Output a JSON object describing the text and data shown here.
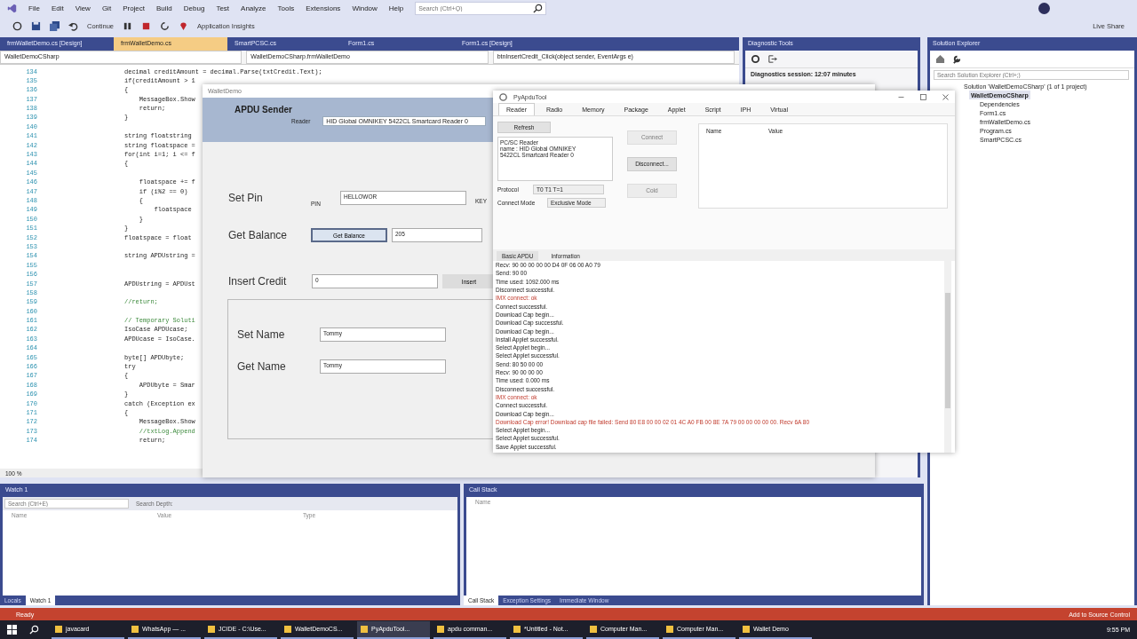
{
  "menu": [
    "File",
    "Edit",
    "View",
    "Git",
    "Project",
    "Build",
    "Debug",
    "Test",
    "Analyze",
    "Tools",
    "Extensions",
    "Window",
    "Help"
  ],
  "search": {
    "placeholder": "Search (Ctrl+Q)"
  },
  "toolbar": {
    "continue": "Continue",
    "insights": "Application Insights",
    "live_share": "Live Share"
  },
  "editor": {
    "tabs": [
      {
        "label": "frmWalletDemo.cs [Design]",
        "selected": false
      },
      {
        "label": "frmWalletDemo.cs",
        "selected": true
      },
      {
        "label": "SmartPCSC.cs",
        "selected": false
      },
      {
        "label": "Form1.cs",
        "selected": false
      },
      {
        "label": "Form1.cs [Design]",
        "selected": false
      }
    ],
    "nav": [
      "WalletDemoCSharp",
      "WalletDemoCSharp.frmWalletDemo",
      "btnInsertCredit_Click(object sender, EventArgs e)"
    ],
    "lines": [
      {
        "n": "134",
        "text": "decimal creditAmount = decimal.Parse(txtCredit.Text);",
        "kind": "code"
      },
      {
        "n": "135",
        "text": "if(creditAmount > 1",
        "kind": "code"
      },
      {
        "n": "136",
        "text": "{",
        "kind": "code"
      },
      {
        "n": "137",
        "text": "    MessageBox.Show",
        "kind": "code"
      },
      {
        "n": "138",
        "text": "    return;",
        "kind": "code"
      },
      {
        "n": "139",
        "text": "}",
        "kind": "code"
      },
      {
        "n": "140"
      },
      {
        "n": "141",
        "text": "string floatstring",
        "kind": "code"
      },
      {
        "n": "142",
        "text": "string floatspace =",
        "kind": "code"
      },
      {
        "n": "143",
        "text": "for(int i=1; i <= f",
        "kind": "code"
      },
      {
        "n": "144",
        "text": "{",
        "kind": "code"
      },
      {
        "n": "145"
      },
      {
        "n": "146",
        "text": "    floatspace += f",
        "kind": "code"
      },
      {
        "n": "147",
        "text": "    if (i%2 == 0)",
        "kind": "code"
      },
      {
        "n": "148",
        "text": "    {",
        "kind": "code"
      },
      {
        "n": "149",
        "text": "        floatspace",
        "kind": "code"
      },
      {
        "n": "150",
        "text": "    }",
        "kind": "code"
      },
      {
        "n": "151",
        "text": "}",
        "kind": "code"
      },
      {
        "n": "152",
        "text": "floatspace = float",
        "kind": "code"
      },
      {
        "n": "153"
      },
      {
        "n": "154",
        "text": "string APDUstring =",
        "kind": "code"
      },
      {
        "n": "155"
      },
      {
        "n": "156"
      },
      {
        "n": "157",
        "text": "APDUstring = APDUst",
        "kind": "code"
      },
      {
        "n": "158"
      },
      {
        "n": "159",
        "text": "//return;",
        "kind": "comment"
      },
      {
        "n": "160"
      },
      {
        "n": "161",
        "text": "// Temporary Soluti",
        "kind": "comment"
      },
      {
        "n": "162",
        "text": "IsoCase APDUcase;",
        "kind": "code"
      },
      {
        "n": "163",
        "text": "APDUcase = IsoCase.",
        "kind": "code"
      },
      {
        "n": "164"
      },
      {
        "n": "165",
        "text": "byte[] APDUbyte;",
        "kind": "code"
      },
      {
        "n": "166",
        "text": "try",
        "kind": "code"
      },
      {
        "n": "167",
        "text": "{",
        "kind": "code"
      },
      {
        "n": "168",
        "text": "    APDUbyte = Smar",
        "kind": "code"
      },
      {
        "n": "169",
        "text": "}",
        "kind": "code"
      },
      {
        "n": "170",
        "text": "catch (Exception ex",
        "kind": "code"
      },
      {
        "n": "171",
        "text": "{",
        "kind": "code"
      },
      {
        "n": "172",
        "text": "    MessageBox.Show",
        "kind": "code"
      },
      {
        "n": "173",
        "text": "    //txtLog.Append",
        "kind": "comment"
      },
      {
        "n": "174",
        "text": "    return;",
        "kind": "code"
      }
    ],
    "zoom": "100 %"
  },
  "diagnostics": {
    "title": "Diagnostic Tools",
    "session": "Diagnostics session: 12:07 minutes"
  },
  "solution_explorer": {
    "title": "Solution Explorer",
    "search": {
      "placeholder": "Search Solution Explorer (Ctrl+;)"
    },
    "tree": [
      {
        "label": "Solution 'WalletDemoCSharp' (1 of 1 project)",
        "selected": false,
        "children": [
          {
            "label": "WalletDemoCSharp",
            "selected": true,
            "children": [
              {
                "label": "Dependencies",
                "selected": false
              },
              {
                "label": "Form1.cs",
                "selected": false
              },
              {
                "label": "frmWalletDemo.cs",
                "selected": false
              },
              {
                "label": "Program.cs",
                "selected": false
              },
              {
                "label": "SmartPCSC.cs",
                "selected": false
              }
            ]
          }
        ]
      }
    ]
  },
  "apdu_sender": {
    "title": "WalletDemo",
    "header": "APDU Sender",
    "reader_label": "Reader",
    "reader": "HID Global OMNIKEY 5422CL Smartcard Reader 0",
    "set_pin": "Set Pin",
    "pin_label": "PIN",
    "pin": "HELLOWOR",
    "key_label": "KEY",
    "get_balance": "Get Balance",
    "balance_button": "Get Balance",
    "balance": "205",
    "insert_credit": "Insert Credit",
    "credit": "0",
    "insert_button": "Insert",
    "set_name": "Set Name",
    "set_name_value": "Tommy",
    "get_name": "Get Name",
    "get_name_value": "Tommy"
  },
  "pyapdutool": {
    "title": "PyApduTool",
    "tabs": [
      {
        "label": "Reader",
        "selected": true
      },
      {
        "label": "Radio",
        "selected": false
      },
      {
        "label": "Memory",
        "selected": false
      },
      {
        "label": "Package",
        "selected": false
      },
      {
        "label": "Applet",
        "selected": false
      },
      {
        "label": "Script",
        "selected": false
      },
      {
        "label": "IPH",
        "selected": false
      },
      {
        "label": "Virtual",
        "selected": false
      }
    ],
    "refresh": "Refresh",
    "readers": [
      "PC/SC Reader",
      "name : HID Global OMNIKEY",
      "5422CL Smartcard Reader 0"
    ],
    "protocol_label": "Protocol",
    "protocol": "T0 T1 T=1",
    "mode_label": "Connect Mode",
    "mode": "Exclusive Mode",
    "buttons": [
      {
        "label": "Connect",
        "disabled": true
      },
      {
        "label": "Disconnect...",
        "disabled": false
      },
      {
        "label": "Cold",
        "disabled": true
      }
    ],
    "columns": [
      "Name",
      "Value"
    ],
    "log_tabs": [
      {
        "label": "Basic APDU",
        "selected": true
      },
      {
        "label": "Information",
        "selected": false
      }
    ],
    "log": [
      {
        "text": "Recv: 90 00 00 00 00 D4 0F 06 00 A0 79",
        "kind": "info"
      },
      {
        "text": "Send: 90 00",
        "kind": "info"
      },
      {
        "text": "Time used: 1092.000 ms",
        "kind": "info"
      },
      {
        "text": "Disconnect successful.",
        "kind": "info"
      },
      {
        "text": "IMX connect: ok",
        "kind": "error"
      },
      {
        "text": "Connect successful.",
        "kind": "info"
      },
      {
        "text": "Download Cap begin...",
        "kind": "info"
      },
      {
        "text": "Download Cap successful.",
        "kind": "info"
      },
      {
        "text": "Download Cap begin...",
        "kind": "info"
      },
      {
        "text": "Install Applet successful.",
        "kind": "info"
      },
      {
        "text": "Select Applet begin...",
        "kind": "info"
      },
      {
        "text": "Select Applet successful.",
        "kind": "info"
      },
      {
        "text": "Send: 80 50 00 00",
        "kind": "info"
      },
      {
        "text": "Recv: 90 00 00 00",
        "kind": "info"
      },
      {
        "text": "Time used: 0.000 ms",
        "kind": "info"
      },
      {
        "text": "Disconnect successful.",
        "kind": "info"
      },
      {
        "text": "IMX connect: ok",
        "kind": "error"
      },
      {
        "text": "Connect successful.",
        "kind": "info"
      },
      {
        "text": "Download Cap begin...",
        "kind": "info"
      },
      {
        "text": "Download Cap error! Download cap file failed: Send 80 E8 00 00 02 01 4C A0 FB 00 8E 7A 79 00 00 00 00 00. Recv 6A 80",
        "kind": "error"
      },
      {
        "text": "Select Applet begin...",
        "kind": "info"
      },
      {
        "text": "Select Applet successful.",
        "kind": "info"
      },
      {
        "text": "Save Applet successful.",
        "kind": "info"
      }
    ]
  },
  "watch": {
    "title": "Watch 1",
    "search": {
      "placeholder": "Search (Ctrl+E)"
    },
    "depth": "Search Depth:",
    "columns": [
      "Name",
      "Value",
      "Type"
    ],
    "tabs": [
      {
        "label": "Locals",
        "selected": false
      },
      {
        "label": "Watch 1",
        "selected": true
      }
    ]
  },
  "call_stack": {
    "title": "Call Stack",
    "columns": [
      "Name"
    ],
    "tabs": [
      {
        "label": "Call Stack",
        "selected": true
      },
      {
        "label": "Exception Settings",
        "selected": false
      },
      {
        "label": "Immediate Window",
        "selected": false
      }
    ]
  },
  "status_bar": {
    "text": "Ready",
    "source_control": "Add to Source Control"
  },
  "taskbar": {
    "apps": [
      {
        "label": "javacard",
        "selected": false
      },
      {
        "label": "WhatsApp — ...",
        "selected": false
      },
      {
        "label": "JCIDE - C:\\Use...",
        "selected": false
      },
      {
        "label": "WalletDemoCS...",
        "selected": false
      },
      {
        "label": "PyApduTool...",
        "selected": true
      },
      {
        "label": "apdu comman...",
        "selected": false
      },
      {
        "label": "*Untitled - Not...",
        "selected": false
      },
      {
        "label": "Computer Man...",
        "selected": false
      },
      {
        "label": "Computer Man...",
        "selected": false
      },
      {
        "label": "Wallet Demo",
        "selected": false
      }
    ],
    "time": "9:55 PM"
  }
}
